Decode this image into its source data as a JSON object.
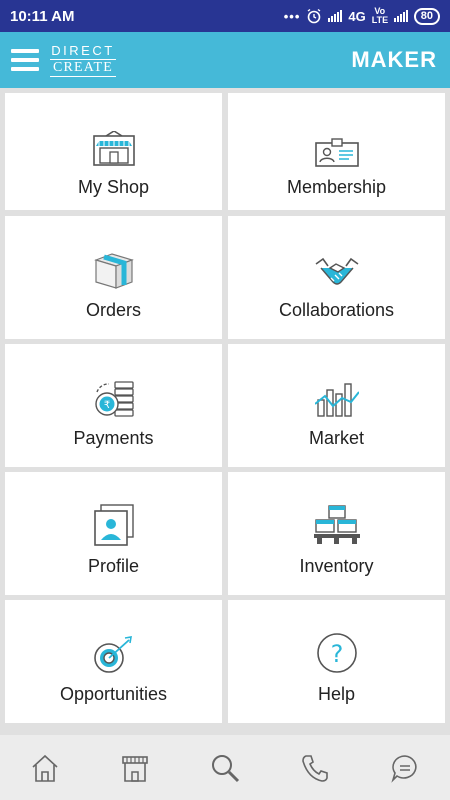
{
  "status_bar": {
    "time": "10:11 AM",
    "network": "4G",
    "volte": "Vo LTE",
    "battery": "80"
  },
  "header": {
    "logo_line1": "DIRECT",
    "logo_line2": "CREATE",
    "role_label": "MAKER"
  },
  "tiles": [
    {
      "label": "My Shop",
      "icon": "shop-icon"
    },
    {
      "label": "Membership",
      "icon": "id-card-icon"
    },
    {
      "label": "Orders",
      "icon": "box-icon"
    },
    {
      "label": "Collaborations",
      "icon": "handshake-icon"
    },
    {
      "label": "Payments",
      "icon": "coins-icon"
    },
    {
      "label": "Market",
      "icon": "bar-chart-icon"
    },
    {
      "label": "Profile",
      "icon": "profile-icon"
    },
    {
      "label": "Inventory",
      "icon": "inventory-icon"
    },
    {
      "label": "Opportunities",
      "icon": "target-icon"
    },
    {
      "label": "Help",
      "icon": "help-icon"
    }
  ],
  "bottom_nav": [
    {
      "name": "home-icon"
    },
    {
      "name": "store-icon"
    },
    {
      "name": "search-icon"
    },
    {
      "name": "phone-icon"
    },
    {
      "name": "chat-icon"
    }
  ],
  "colors": {
    "status_bar": "#283593",
    "app_bar": "#45b9d8",
    "accent": "#29b6d8",
    "icon_stroke": "#555555"
  }
}
